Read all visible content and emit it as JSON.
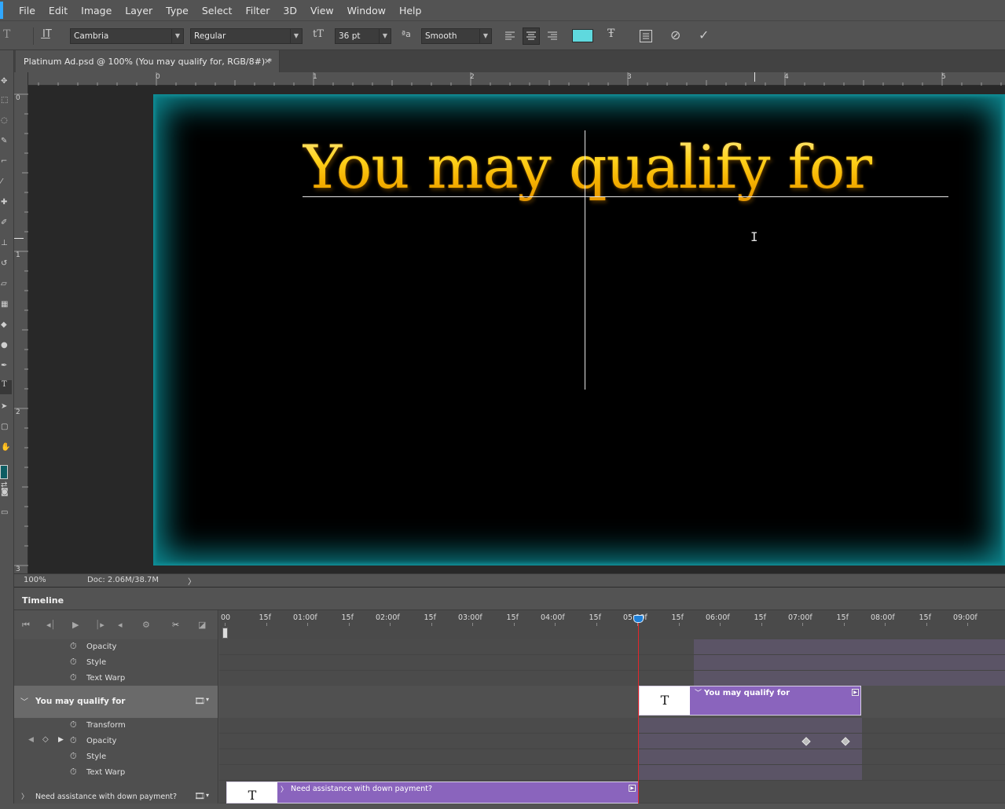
{
  "menubar": {
    "items": [
      "File",
      "Edit",
      "Image",
      "Layer",
      "Type",
      "Select",
      "Filter",
      "3D",
      "View",
      "Window",
      "Help"
    ]
  },
  "options": {
    "tool_icon": "type-tool-icon",
    "font_family": "Cambria",
    "font_style": "Regular",
    "font_size": "36 pt",
    "antialias": "Smooth",
    "text_color": "#5fd9de"
  },
  "document": {
    "tab_title": "Platinum Ad.psd @ 100% (You may qualify for, RGB/8#) *",
    "close_glyph": "×",
    "headline": "You may qualify for",
    "ruler_top_labels": [
      "0",
      "1",
      "2",
      "3",
      "4",
      "5"
    ],
    "ruler_left_labels": [
      "0",
      "1",
      "2",
      "3"
    ]
  },
  "status": {
    "zoom": "100%",
    "doc_size": "Doc: 2.06M/38.7M",
    "arrow": "〉"
  },
  "timeline": {
    "tab_label": "Timeline",
    "ruler_labels": [
      "00",
      "15f",
      "01:00f",
      "15f",
      "02:00f",
      "15f",
      "03:00f",
      "15f",
      "04:00f",
      "15f",
      "05:00f",
      "15f",
      "06:00f",
      "15f",
      "07:00f",
      "15f",
      "08:00f",
      "15f",
      "09:00f"
    ],
    "playhead_time": "05:00f",
    "upper_props": [
      "Opacity",
      "Style",
      "Text Warp"
    ],
    "layer_name": "You may qualify for",
    "layer_props": [
      "Transform",
      "Opacity",
      "Style",
      "Text Warp"
    ],
    "clip_name": "You may qualify for",
    "clip_thumb": "T",
    "next_layer_name": "Need assistance with down payment?",
    "next_clip_name": "Need assistance with down payment?",
    "next_clip_thumb": "T",
    "accent_clip_color": "#8a64bd",
    "playhead_color": "#e2262b"
  }
}
